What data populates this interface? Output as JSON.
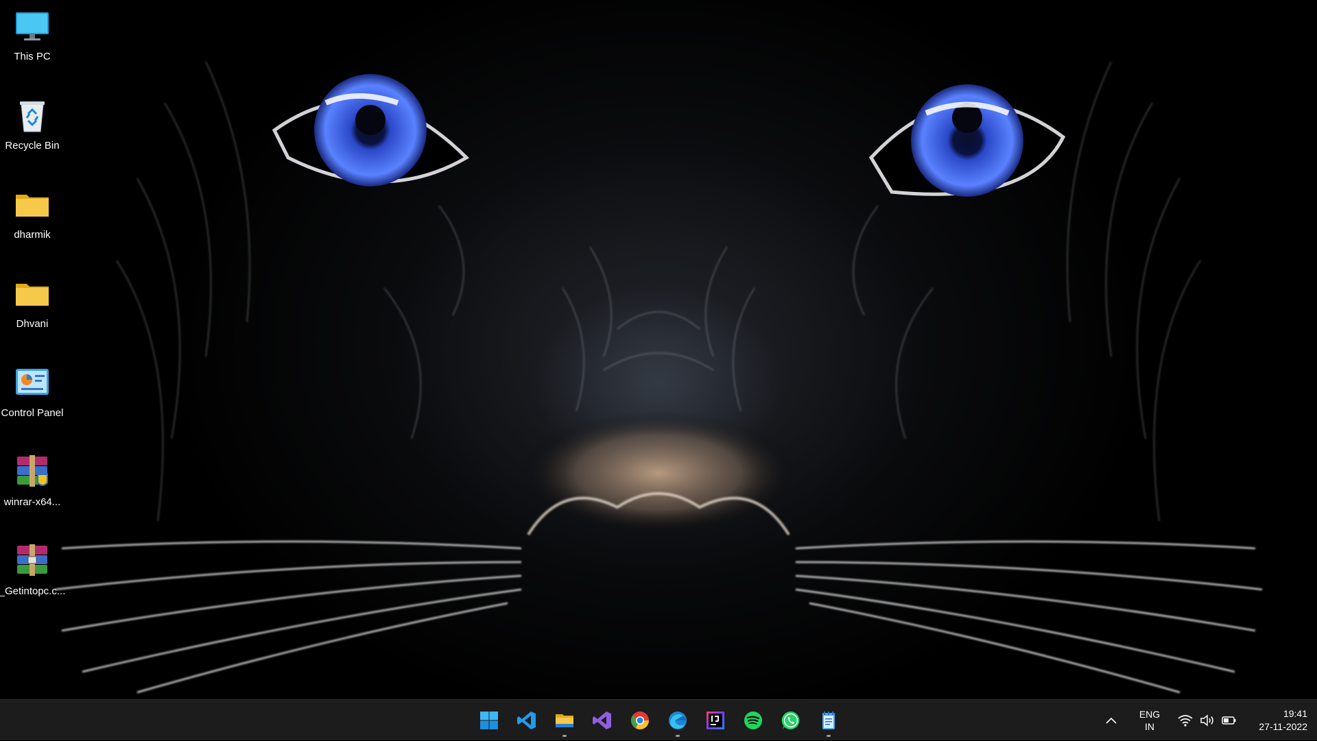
{
  "desktop": {
    "icons": [
      {
        "label": "This PC",
        "icon": "monitor-icon"
      },
      {
        "label": "Recycle Bin",
        "icon": "recycle-bin-icon"
      },
      {
        "label": "dharmik",
        "icon": "folder-icon"
      },
      {
        "label": "Dhvani",
        "icon": "folder-icon"
      },
      {
        "label": "Control Panel",
        "icon": "control-panel-icon"
      },
      {
        "label": "winrar-x64...",
        "icon": "winrar-installer-icon"
      },
      {
        "label": "_Getintopc.c...",
        "icon": "winrar-archive-icon"
      }
    ]
  },
  "taskbar": {
    "apps": [
      {
        "name": "Start",
        "icon": "windows-start-icon",
        "running": false
      },
      {
        "name": "Visual Studio Code",
        "icon": "vscode-icon",
        "running": false
      },
      {
        "name": "File Explorer",
        "icon": "file-explorer-icon",
        "running": true
      },
      {
        "name": "Visual Studio",
        "icon": "visual-studio-icon",
        "running": false
      },
      {
        "name": "Google Chrome",
        "icon": "chrome-icon",
        "running": false
      },
      {
        "name": "Microsoft Edge",
        "icon": "edge-icon",
        "running": true
      },
      {
        "name": "IntelliJ IDEA",
        "icon": "intellij-icon",
        "running": false
      },
      {
        "name": "Spotify",
        "icon": "spotify-icon",
        "running": false
      },
      {
        "name": "WhatsApp",
        "icon": "whatsapp-icon",
        "running": false
      },
      {
        "name": "Notepad",
        "icon": "notepad-icon",
        "running": true
      }
    ],
    "tray": {
      "language_line1": "ENG",
      "language_line2": "IN",
      "time": "19:41",
      "date": "27-11-2022",
      "icons": [
        "show-hidden-icons-chevron",
        "wifi-icon",
        "volume-icon",
        "battery-icon"
      ]
    }
  },
  "colors": {
    "taskbar_bg": "#1c1c1c",
    "eye_blue": "#3a5ad8",
    "folder_yellow": "#f6c94a"
  }
}
